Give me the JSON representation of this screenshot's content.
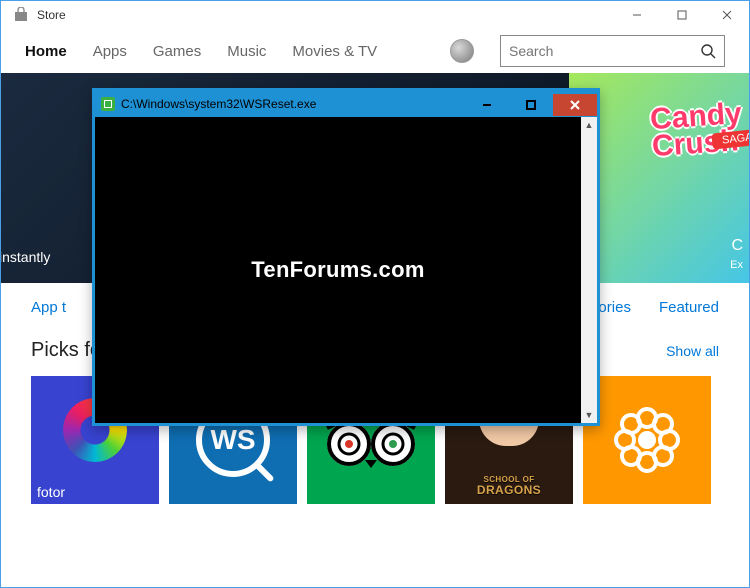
{
  "store_window": {
    "title": "Store",
    "nav": [
      "Home",
      "Apps",
      "Games",
      "Music",
      "Movies & TV"
    ],
    "active_nav_index": 0,
    "search_placeholder": "Search"
  },
  "hero": {
    "left_caption": "instantly",
    "right_logo_top": "Candy",
    "right_logo_bottom": "Crush",
    "right_badge": "SAGA",
    "right_title_letter": "C",
    "right_sub": "Ex"
  },
  "tabs": {
    "left_partial": "App t",
    "right_partial": "egories",
    "featured": "Featured"
  },
  "picks": {
    "heading": "Picks for you",
    "show_all": "Show all",
    "tiles": [
      {
        "name": "fotor",
        "label": "fotor"
      },
      {
        "name": "ws",
        "label": "WS"
      },
      {
        "name": "tripadvisor",
        "label": ""
      },
      {
        "name": "dragons",
        "small": "SCHOOL OF",
        "big": "DRAGONS"
      },
      {
        "name": "gotomeeting",
        "label": ""
      }
    ]
  },
  "cmd_window": {
    "title": "C:\\Windows\\system32\\WSReset.exe",
    "watermark": "TenForums.com"
  }
}
